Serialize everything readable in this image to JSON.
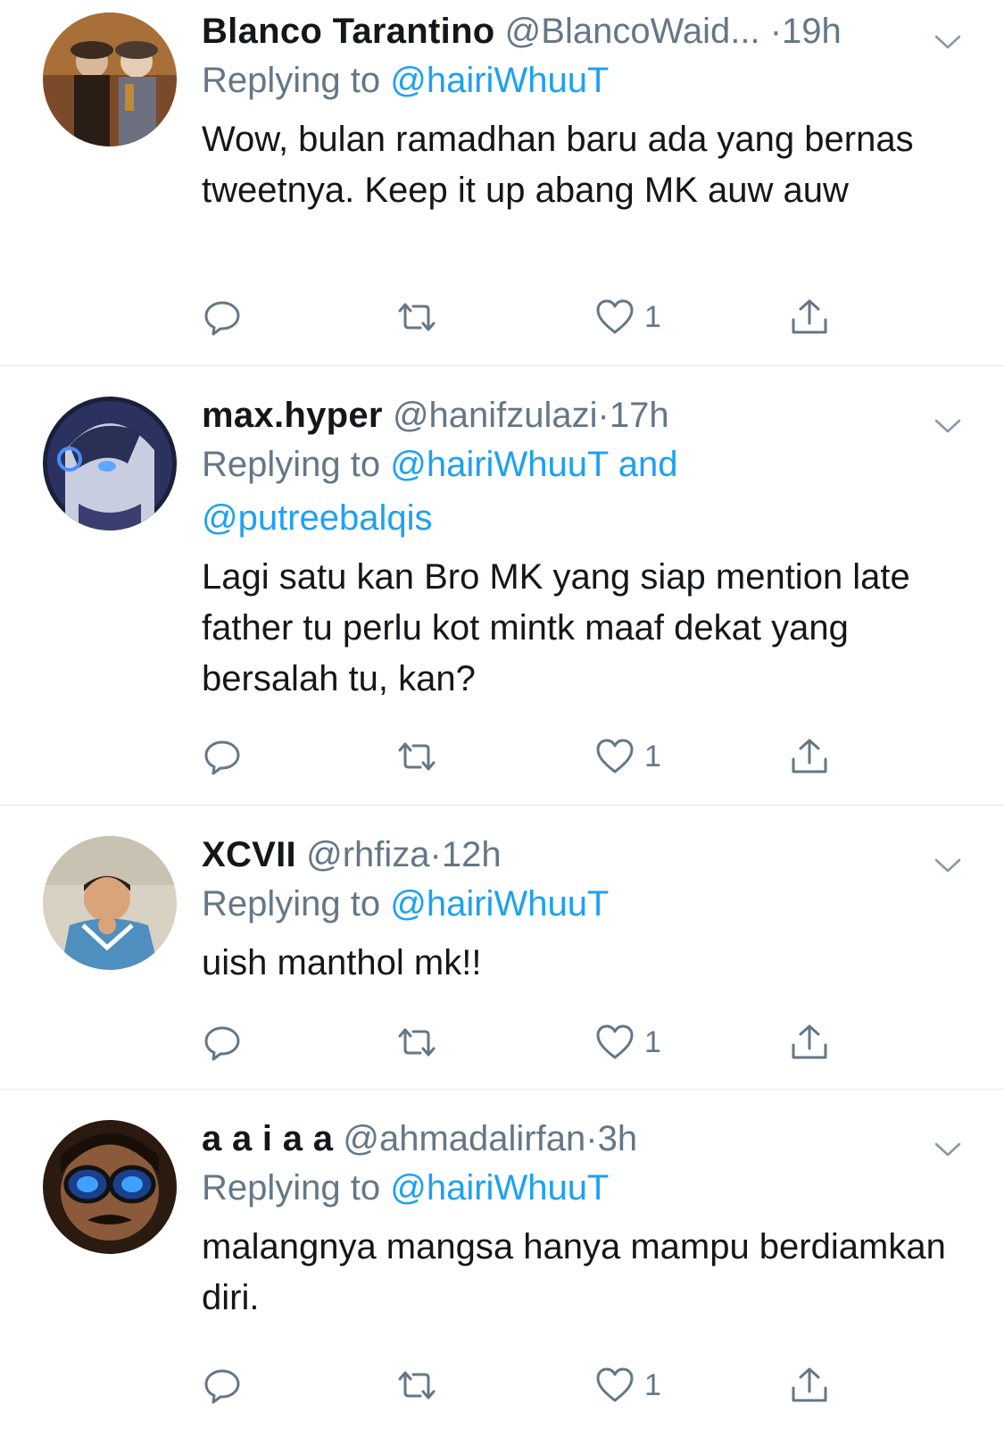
{
  "colors": {
    "link": "#1da1f2",
    "muted": "#657786",
    "text": "#14171a",
    "divider": "#e1e8ed"
  },
  "replies": [
    {
      "name": "Blanco Tarantino",
      "handle": "@BlancoWaid...",
      "dot": "·",
      "time": "19h",
      "replying_label": "Replying to",
      "mentions": [
        "@hairiWhuuT"
      ],
      "mentions_joiner": "",
      "text": "Wow, bulan ramadhan baru ada yang bernas tweetnya. Keep it up abang MK auw auw",
      "like_count": "1",
      "avatar_icon": "avatar-photo-two-women"
    },
    {
      "name": "max.hyper",
      "handle": "@hanifzulazi",
      "dot": "·",
      "time": "17h",
      "replying_label": "Replying to",
      "mentions": [
        "@hairiWhuuT",
        "@putreebalqis"
      ],
      "mentions_joiner": "and",
      "text": "Lagi satu kan Bro MK yang siap mention late father tu perlu kot mintk maaf dekat yang bersalah tu, kan?",
      "like_count": "1",
      "avatar_icon": "avatar-anime-character"
    },
    {
      "name": "XCVII",
      "handle": "@rhfiza",
      "dot": "·",
      "time": "12h",
      "replying_label": "Replying to",
      "mentions": [
        "@hairiWhuuT"
      ],
      "mentions_joiner": "",
      "text": "uish manthol mk!!",
      "like_count": "1",
      "avatar_icon": "avatar-child-photo"
    },
    {
      "name": "a a i a a",
      "handle": "@ahmadalirfan",
      "dot": "·",
      "time": "3h",
      "replying_label": "Replying to",
      "mentions": [
        "@hairiWhuuT"
      ],
      "mentions_joiner": "",
      "text": "malangnya mangsa hanya mampu berdiamkan diri.",
      "like_count": "1",
      "avatar_icon": "avatar-man-sunglasses"
    }
  ]
}
